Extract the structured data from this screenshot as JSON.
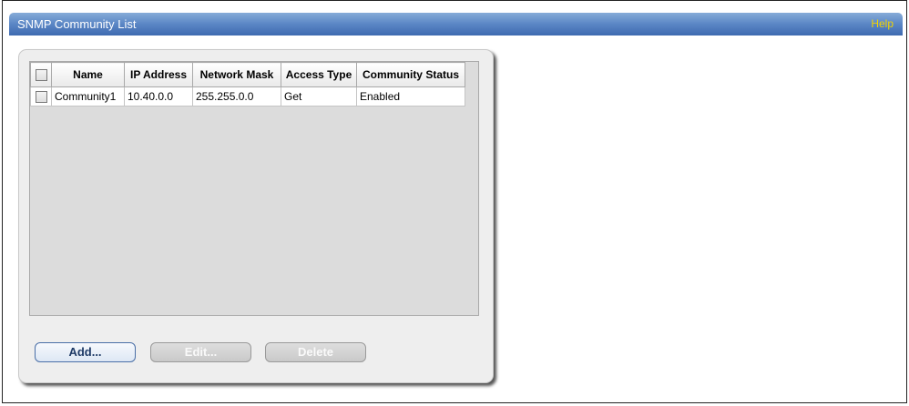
{
  "header": {
    "title": "SNMP Community List",
    "help_label": "Help"
  },
  "table": {
    "columns": [
      "Name",
      "IP Address",
      "Network Mask",
      "Access Type",
      "Community Status"
    ],
    "rows": [
      {
        "checked": false,
        "name": "Community1",
        "ip_address": "10.40.0.0",
        "network_mask": "255.255.0.0",
        "access_type": "Get",
        "community_status": "Enabled"
      }
    ]
  },
  "buttons": {
    "add": "Add...",
    "edit": "Edit...",
    "delete": "Delete"
  },
  "colors": {
    "title_bar": "#5a86c5",
    "help_link": "#f3d300",
    "button_border": "#4a6fa7"
  }
}
